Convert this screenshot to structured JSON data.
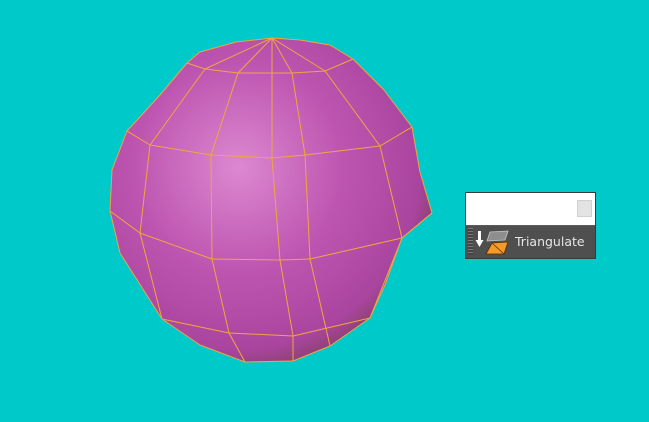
{
  "viewport": {
    "background_color": "#00c9c9",
    "object": "sphere-mesh",
    "mesh_fill_color": "#c25bb5",
    "mesh_edge_color": "#f0a640"
  },
  "tool_panel": {
    "close_icon": "close-icon",
    "tool": {
      "label": "Triangulate",
      "icon": "triangulate-icon"
    }
  }
}
